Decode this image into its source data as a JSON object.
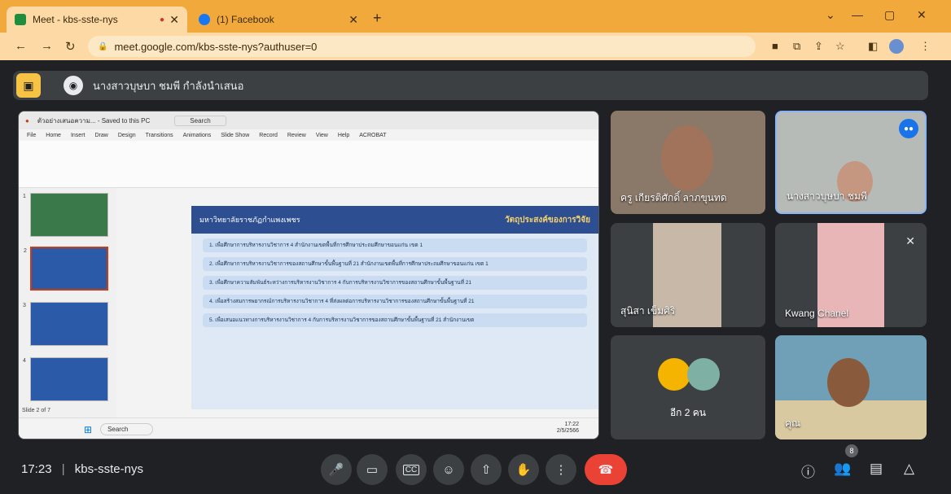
{
  "browser": {
    "tabs": [
      {
        "title": "Meet - kbs-sste-nys"
      },
      {
        "title": "(1) Facebook"
      }
    ],
    "url": "meet.google.com/kbs-sste-nys?authuser=0"
  },
  "banner": {
    "presenter_text": "นางสาวบุษบา ชมพี กำลังนำเสนอ"
  },
  "presentation": {
    "ppt_title": "ตัวอย่างเสนอความ... - Saved to this PC",
    "search": "Search",
    "menu": [
      "File",
      "Home",
      "Insert",
      "Draw",
      "Design",
      "Transitions",
      "Animations",
      "Slide Show",
      "Record",
      "Review",
      "View",
      "Help",
      "ACROBAT"
    ],
    "slide_header_left": "มหาวิทยาลัยราชภัฏกำแพงเพชร",
    "slide_header_right": "วัตถุประสงค์ของการวิจัย",
    "bullets": [
      "1. เพื่อศึกษาการบริหารงานวิชาการ 4 สำนักงานเขตพื้นที่การศึกษาประถมศึกษาขอนแก่น เขต 1",
      "2. เพื่อศึกษาการบริหารงานวิชาการของสถานศึกษาขั้นพื้นฐานที่ 21 สำนักงานเขตพื้นที่การศึกษาประถมศึกษาขอนแก่น เขต 1",
      "3. เพื่อศึกษาความสัมพันธ์ระหว่างการบริหารงานวิชาการ 4 กับการบริหารงานวิชาการของสถานศึกษาขั้นพื้นฐานที่ 21",
      "4. เพื่อสร้างสมการพยากรณ์การบริหารงานวิชาการ 4 ที่ส่งผลต่อการบริหารงานวิชาการของสถานศึกษาขั้นพื้นฐานที่ 21",
      "5. เพื่อเสนอแนวทางการบริหารงานวิชาการ 4 กับการบริหารงานวิชาการของสถานศึกษาขั้นพื้นฐานที่ 21 สำนักงานเขต"
    ],
    "status": "Slide 2 of 7",
    "taskbar_search": "Search",
    "clock_time": "17:22",
    "clock_date": "2/5/2566"
  },
  "participants": [
    {
      "name": "ครู เกียรติศักดิ์ ลาภขุนทด"
    },
    {
      "name": "นางสาวบุษบา ชมพี"
    },
    {
      "name": "สุนิสา เข็มศิริ"
    },
    {
      "name": "Kwang Chanel"
    },
    {
      "name": "อีก 2 คน"
    },
    {
      "name": "คุณ"
    }
  ],
  "bottom": {
    "time": "17:23",
    "separator": "|",
    "code": "kbs-sste-nys",
    "participant_count": "8"
  },
  "icons": {
    "mic": "mic-icon",
    "camera": "camera-icon",
    "captions": "captions-icon",
    "emoji": "emoji-icon",
    "present": "present-icon",
    "hand": "raise-hand-icon",
    "more": "more-icon",
    "end": "end-call-icon",
    "info": "info-icon",
    "people": "people-icon",
    "chat": "chat-icon",
    "activities": "activities-icon"
  },
  "colors": {
    "end_call": "#ea4335",
    "tab_bar": "#f2a93b",
    "banner_icon": "#f6c344"
  }
}
